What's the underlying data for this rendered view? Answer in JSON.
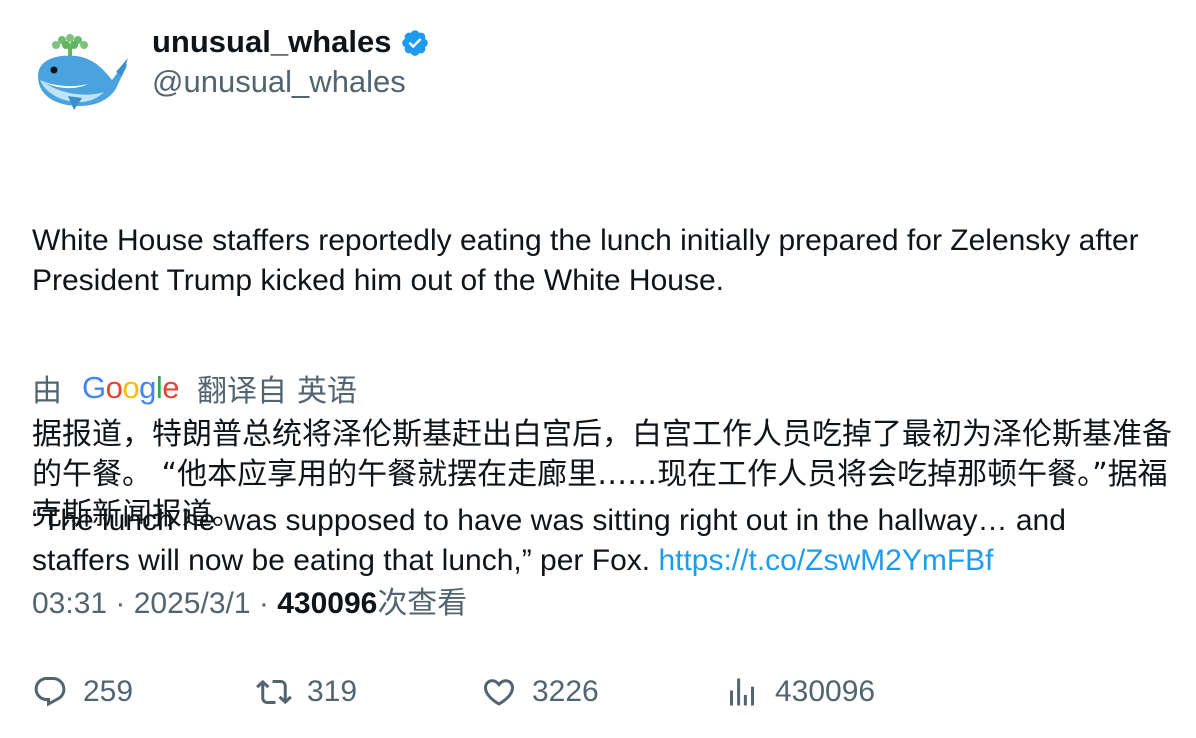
{
  "author": {
    "display_name": "unusual_whales",
    "handle": "@unusual_whales",
    "verified": true,
    "verified_color": "#1d9bf0",
    "avatar_icon": "whale-icon"
  },
  "tweet": {
    "paragraph_1": "White House staffers reportedly eating the lunch initially prepared for Zelensky after President Trump kicked him out of the White House.",
    "paragraph_2": "“The lunch he was supposed to have was sitting right out in the hallway… and staffers will now be eating that lunch,” per Fox. ",
    "link": "https://t.co/ZswM2YmFBf"
  },
  "translation": {
    "prefix": "由",
    "provider": "Google",
    "suffix": "翻译自",
    "language": "英语",
    "text": "据报道，特朗普总统将泽伦斯基赶出白宫后，白宫工作人员吃掉了最初为泽伦斯基准备的午餐。 “他本应享用的午餐就摆在走廊里……现在工作人员将会吃掉那顿午餐。”据福克斯新闻报道。"
  },
  "meta": {
    "time": "03:31",
    "separator": " · ",
    "date": "2025/3/1",
    "views": "430096",
    "views_label": "次查看"
  },
  "actions": {
    "replies": "259",
    "retweets": "319",
    "likes": "3226",
    "views": "430096"
  },
  "colors": {
    "text": "#0f1419",
    "secondary": "#536471",
    "link": "#1d9bf0"
  }
}
